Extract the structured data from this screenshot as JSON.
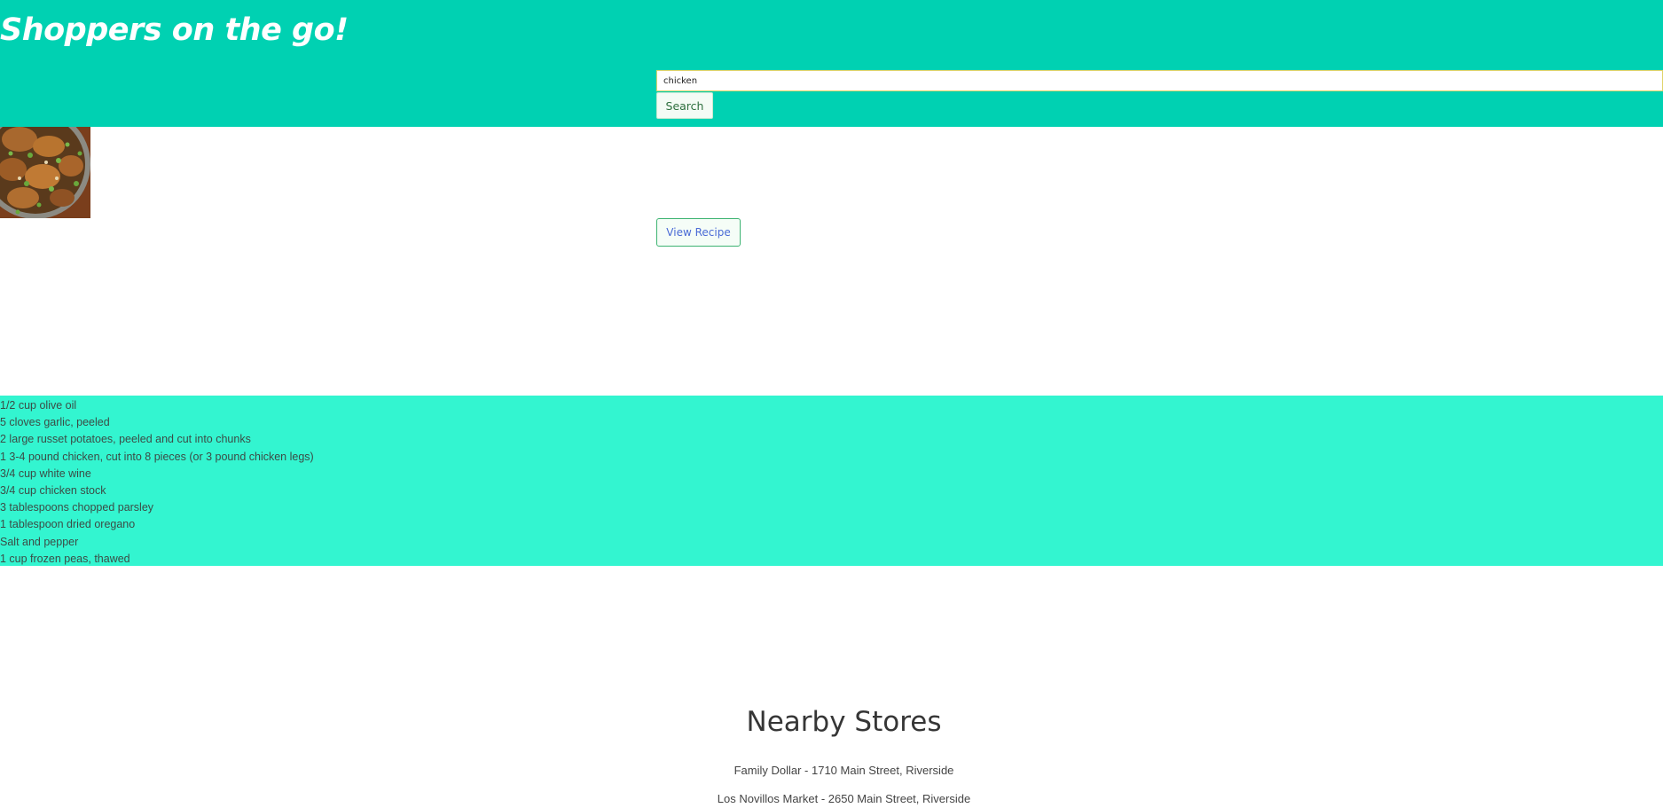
{
  "header": {
    "title": "Shoppers on the go!",
    "background_color": "#00d1b2"
  },
  "search": {
    "value": "chicken",
    "button_label": "Search"
  },
  "recipe": {
    "view_button_label": "View Recipe",
    "ingredients": [
      "1/2 cup olive oil",
      "5 cloves garlic, peeled",
      "2 large russet potatoes, peeled and cut into chunks",
      "1 3-4 pound chicken, cut into 8 pieces (or 3 pound chicken legs)",
      "3/4 cup white wine",
      "3/4 cup chicken stock",
      "3 tablespoons chopped parsley",
      "1 tablespoon dried oregano",
      "Salt and pepper",
      "1 cup frozen peas, thawed"
    ],
    "ingredients_background_color": "#33f5d0"
  },
  "stores": {
    "heading": "Nearby Stores",
    "items": [
      "Family Dollar - 1710 Main Street, Riverside",
      "Los Novillos Market - 2650 Main Street, Riverside"
    ]
  }
}
